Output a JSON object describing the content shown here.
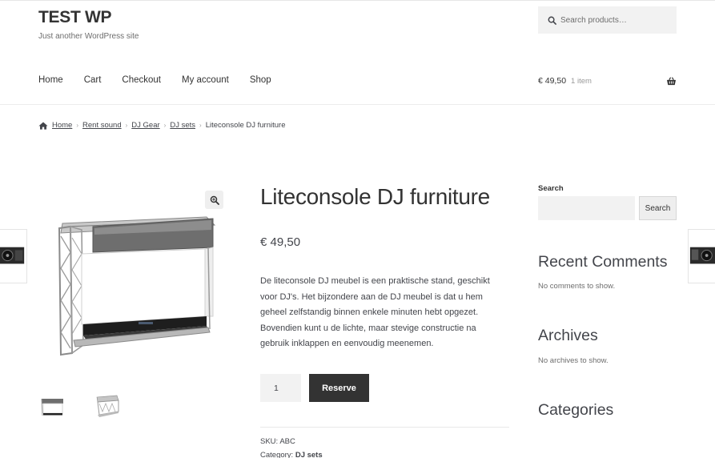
{
  "site": {
    "title": "TEST WP",
    "tagline": "Just another WordPress site"
  },
  "header": {
    "search_placeholder": "Search products…",
    "nav": [
      "Home",
      "Cart",
      "Checkout",
      "My account",
      "Shop"
    ],
    "cart": {
      "total": "€ 49,50",
      "count": "1 item"
    }
  },
  "breadcrumb": [
    "Home",
    "Rent sound",
    "DJ Gear",
    "DJ sets",
    "Liteconsole DJ furniture"
  ],
  "product": {
    "title": "Liteconsole DJ furniture",
    "price": "€ 49,50",
    "description": "De liteconsole DJ meubel is een praktische stand, geschikt voor DJ's. Het bijzondere aan de DJ meubel is dat u hem geheel zelfstandig binnen enkele minuten hebt opgezet. Bovendien kunt u de lichte, maar stevige constructie na gebruik inklappen en eenvoudig meenemen.",
    "quantity": "1",
    "button_label": "Reserve",
    "sku_label": "SKU:",
    "sku": "ABC",
    "category_label": "Category:",
    "category": "DJ sets"
  },
  "sidebar": {
    "search_label": "Search",
    "search_button": "Search",
    "recent_comments_title": "Recent Comments",
    "recent_comments_text": "No comments to show.",
    "archives_title": "Archives",
    "archives_text": "No archives to show.",
    "categories_title": "Categories"
  },
  "icons": {
    "search": "search-icon",
    "cart": "basket-icon",
    "home": "home-icon",
    "zoom": "zoom-icon"
  },
  "colors": {
    "text": "#43454b",
    "heading": "#333333",
    "button": "#333333",
    "field": "#f2f2f2"
  }
}
